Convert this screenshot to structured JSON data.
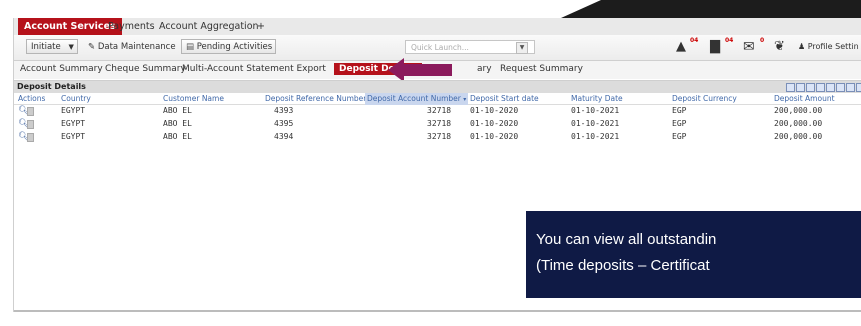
{
  "top_tabs": [
    {
      "label": "Account Services",
      "active": true
    },
    {
      "label": "Payments",
      "active": false
    },
    {
      "label": "Account Aggregation",
      "active": false
    },
    {
      "label": "+",
      "active": false
    }
  ],
  "toolbar": {
    "initiate_label": "Initiate",
    "data_maintenance_label": "Data Maintenance",
    "pending_activities_label": "Pending Activities",
    "quick_launch_placeholder": "Quick Launch...",
    "badge_alerts": "04",
    "badge_messages": "04",
    "badge_mail": "0",
    "profile_label": "Profile Settin"
  },
  "sub_tabs": [
    {
      "label": "Account Summary",
      "active": false
    },
    {
      "label": "Cheque Summary",
      "active": false
    },
    {
      "label": "Multi-Account Statement Export",
      "active": false
    },
    {
      "label": "Deposit Details",
      "active": true
    },
    {
      "label": "ary",
      "active": false
    },
    {
      "label": "Request Summary",
      "active": false
    }
  ],
  "panel": {
    "title": "Deposit Details"
  },
  "table": {
    "columns": [
      "Actions",
      "Country",
      "Customer Name",
      "Deposit Reference Number",
      "Deposit Account Number",
      "Deposit Start date",
      "Maturity Date",
      "Deposit Currency",
      "Deposit Amount"
    ],
    "sorted_column": "Deposit Account Number",
    "rows": [
      {
        "country": "EGYPT",
        "customer": "ABO EL",
        "ref": "4393",
        "account": "32718",
        "start": "01-10-2020",
        "maturity": "01-10-2021",
        "currency": "EGP",
        "amount": "200,000.00"
      },
      {
        "country": "EGYPT",
        "customer": "ABO EL",
        "ref": "4395",
        "account": "32718",
        "start": "01-10-2020",
        "maturity": "01-10-2021",
        "currency": "EGP",
        "amount": "200,000.00"
      },
      {
        "country": "EGYPT",
        "customer": "ABO EL",
        "ref": "4394",
        "account": "32718",
        "start": "01-10-2020",
        "maturity": "01-10-2021",
        "currency": "EGP",
        "amount": "200,000.00"
      }
    ]
  },
  "callout": {
    "line1": "You can view all outstandin",
    "line2": "(Time deposits – Certificat"
  },
  "colors": {
    "brand_red": "#b5121b",
    "callout_bg": "#0f1a45",
    "link_blue": "#4169a9",
    "arrow": "#8b1a5c"
  }
}
